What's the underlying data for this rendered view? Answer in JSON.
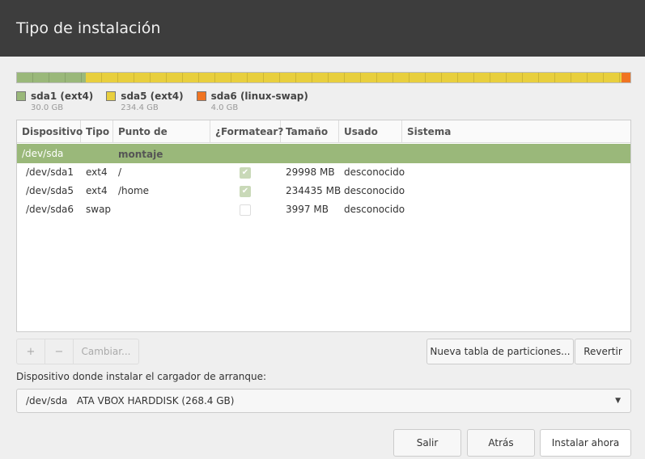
{
  "header": {
    "title": "Tipo de instalación"
  },
  "partitions_bar": [
    {
      "name": "sda1 (ext4)",
      "size": "30.0 GB",
      "color": "#9ab87a",
      "gb": 30.0
    },
    {
      "name": "sda5 (ext4)",
      "size": "234.4 GB",
      "color": "#e8cf3e",
      "gb": 234.4
    },
    {
      "name": "sda6 (linux-swap)",
      "size": "4.0 GB",
      "color": "#f07422",
      "gb": 4.0
    }
  ],
  "table": {
    "columns": [
      "Dispositivo",
      "Tipo",
      "Punto de montaje",
      "¿Formatear?",
      "Tamaño",
      "Usado",
      "Sistema"
    ],
    "disk": "/dev/sda",
    "rows": [
      {
        "device": "/dev/sda1",
        "type": "ext4",
        "mount": "/",
        "format": true,
        "size": "29998 MB",
        "used": "desconocido",
        "system": ""
      },
      {
        "device": "/dev/sda5",
        "type": "ext4",
        "mount": "/home",
        "format": true,
        "size": "234435 MB",
        "used": "desconocido",
        "system": ""
      },
      {
        "device": "/dev/sda6",
        "type": "swap",
        "mount": "",
        "format": false,
        "size": "3997 MB",
        "used": "desconocido",
        "system": ""
      }
    ]
  },
  "toolbar": {
    "add": "+",
    "remove": "−",
    "change": "Cambiar...",
    "new_table": "Nueva tabla de particiones...",
    "revert": "Revertir"
  },
  "bootloader": {
    "label": "Dispositivo donde instalar el cargador de arranque:",
    "value": "/dev/sda   ATA VBOX HARDDISK (268.4 GB)"
  },
  "footer": {
    "quit": "Salir",
    "back": "Atrás",
    "install": "Instalar ahora"
  }
}
